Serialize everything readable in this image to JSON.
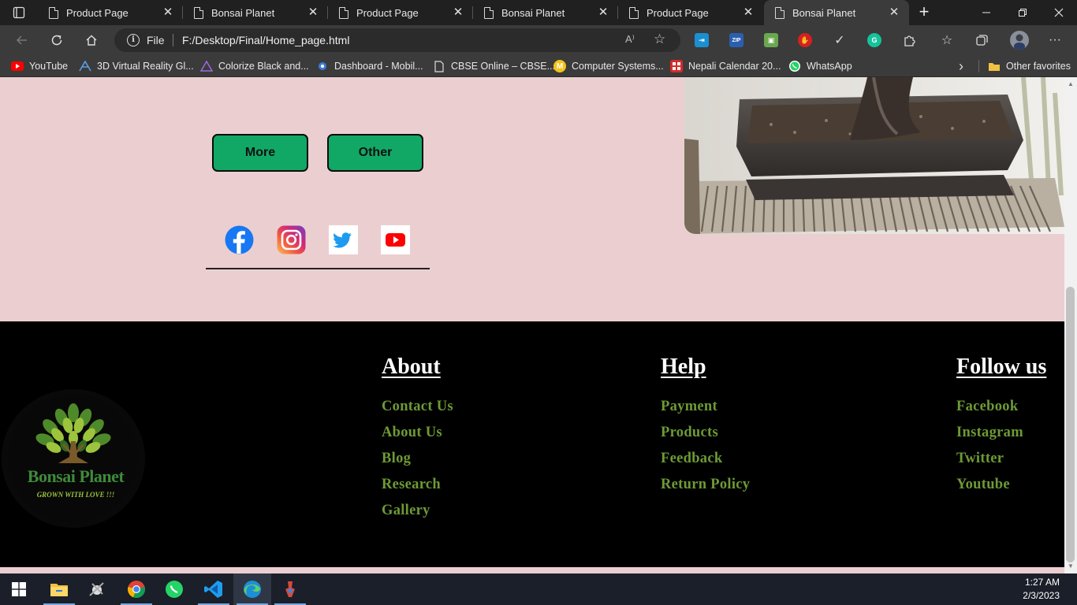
{
  "browser": {
    "tabs": [
      {
        "title": "Product Page",
        "active": false
      },
      {
        "title": "Bonsai Planet",
        "active": false
      },
      {
        "title": "Product Page",
        "active": false
      },
      {
        "title": "Bonsai Planet",
        "active": false
      },
      {
        "title": "Product Page",
        "active": false
      },
      {
        "title": "Bonsai Planet",
        "active": true
      }
    ],
    "address": {
      "scheme": "File",
      "url": "F:/Desktop/Final/Home_page.html"
    },
    "extensions": [
      "zip-extension-icon",
      "green-extension-icon",
      "red-hand-extension-icon",
      "check-icon",
      "grammarly-icon"
    ],
    "bookmarks": [
      {
        "label": "YouTube",
        "icon": "youtube-icon"
      },
      {
        "label": "3D Virtual Reality Gl...",
        "icon": "vr-icon"
      },
      {
        "label": "Colorize Black and...",
        "icon": "triangle-icon"
      },
      {
        "label": "Dashboard - Mobil...",
        "icon": "dashboard-icon"
      },
      {
        "label": "CBSE Online – CBSE...",
        "icon": "page-icon"
      },
      {
        "label": "Computer Systems...",
        "icon": "mcgraw-icon"
      },
      {
        "label": "Nepali Calendar 20...",
        "icon": "calendar-icon"
      },
      {
        "label": "WhatsApp",
        "icon": "whatsapp-icon"
      }
    ],
    "other_favorites": "Other favorites"
  },
  "page": {
    "buttons": {
      "more": "More",
      "other": "Other"
    },
    "social_icons": [
      "facebook-icon",
      "instagram-icon",
      "twitter-icon",
      "youtube-icon"
    ],
    "logo": {
      "name": "Bonsai Planet",
      "tagline": "GROWN WITH LOVE !!!"
    },
    "footer": {
      "about": {
        "title": "About",
        "links": [
          "Contact Us",
          "About Us",
          "Blog",
          "Research",
          "Gallery"
        ]
      },
      "help": {
        "title": "Help",
        "links": [
          "Payment",
          "Products",
          "Feedback",
          "Return Policy"
        ]
      },
      "follow": {
        "title": "Follow us",
        "links": [
          "Facebook",
          "Instagram",
          "Twitter",
          "Youtube"
        ]
      }
    },
    "colors": {
      "page_background": "#ebcfd0",
      "button_green": "#11a866",
      "footer_background": "#000000",
      "footer_link": "#6e9a35"
    }
  },
  "taskbar": {
    "time": "1:27 AM",
    "date": "2/3/2023",
    "apps": [
      "start-icon",
      "file-explorer-icon",
      "satellite-app-icon",
      "chrome-icon",
      "whatsapp-icon",
      "vscode-icon",
      "edge-icon",
      "other-app-icon"
    ]
  }
}
